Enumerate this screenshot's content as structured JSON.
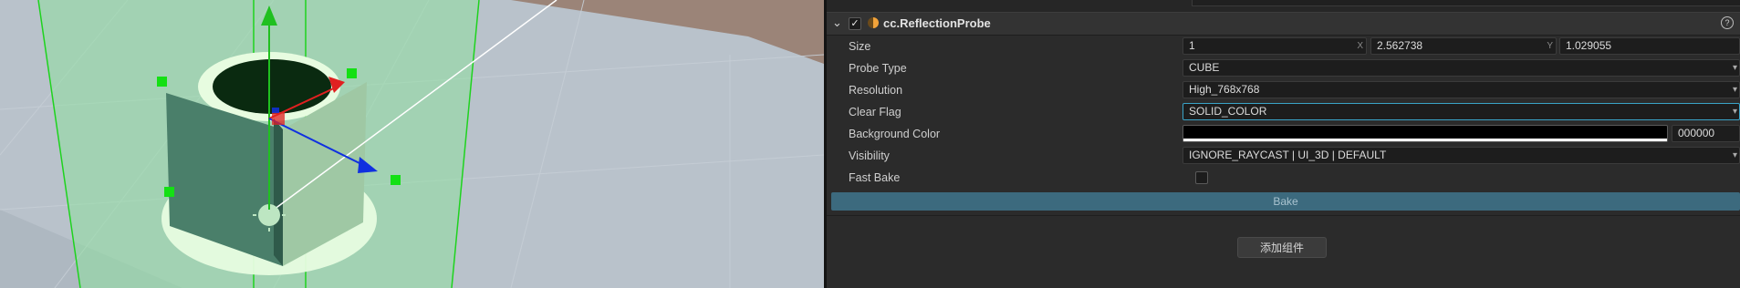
{
  "component": {
    "title": "cc.ReflectionProbe",
    "enabled": true,
    "help_icon": "help-icon",
    "icon": "reflection-probe-icon"
  },
  "properties": {
    "size": {
      "label": "Size",
      "x": "1",
      "x_axis": "X",
      "y": "2.562738",
      "y_axis": "Y",
      "z": "1.029055"
    },
    "probe_type": {
      "label": "Probe Type",
      "value": "CUBE"
    },
    "resolution": {
      "label": "Resolution",
      "value": "High_768x768"
    },
    "clear_flag": {
      "label": "Clear Flag",
      "value": "SOLID_COLOR"
    },
    "background_color": {
      "label": "Background Color",
      "hex": "000000",
      "color": "#000000"
    },
    "visibility": {
      "label": "Visibility",
      "value": "IGNORE_RAYCAST | UI_3D | DEFAULT"
    },
    "fast_bake": {
      "label": "Fast Bake",
      "checked": false
    }
  },
  "buttons": {
    "bake": "Bake",
    "add_component": "添加组件"
  },
  "colors": {
    "accent": "#3aa3c7",
    "bake_button": "#3c6a7e",
    "probe_volume": "#8fe0a0",
    "gizmo_x": "#e02020",
    "gizmo_y": "#20c020",
    "gizmo_z": "#1030e0"
  }
}
